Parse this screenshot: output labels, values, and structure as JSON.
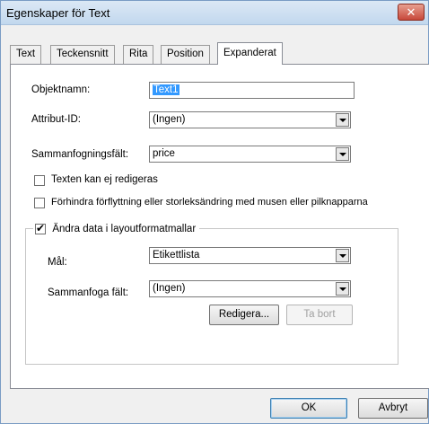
{
  "window": {
    "title": "Egenskaper för Text",
    "close_label": "✕"
  },
  "tabs": [
    {
      "label": "Text"
    },
    {
      "label": "Teckensnitt"
    },
    {
      "label": "Rita"
    },
    {
      "label": "Position"
    },
    {
      "label": "Expanderat"
    }
  ],
  "fields": {
    "object_name_label": "Objektnamn:",
    "object_name_value": "Text1",
    "attribute_id_label": "Attribut-ID:",
    "attribute_id_value": "(Ingen)",
    "merge_field_label": "Sammanfogningsfält:",
    "merge_field_value": "price"
  },
  "checkboxes": {
    "not_editable": {
      "label": "Texten kan ej redigeras",
      "checked": false
    },
    "prevent_move": {
      "label": "Förhindra förflyttning eller storleksändring med musen eller pilknapparna",
      "checked": false
    }
  },
  "group": {
    "legend": "Ändra data i layoutformatmallar",
    "checked": true,
    "target_label": "Mål:",
    "target_value": "Etikettlista",
    "merge_label": "Sammanfoga fält:",
    "merge_value": "(Ingen)",
    "edit_button": "Redigera...",
    "remove_button": "Ta bort"
  },
  "footer": {
    "ok_button": "OK",
    "cancel_button": "Avbryt"
  }
}
